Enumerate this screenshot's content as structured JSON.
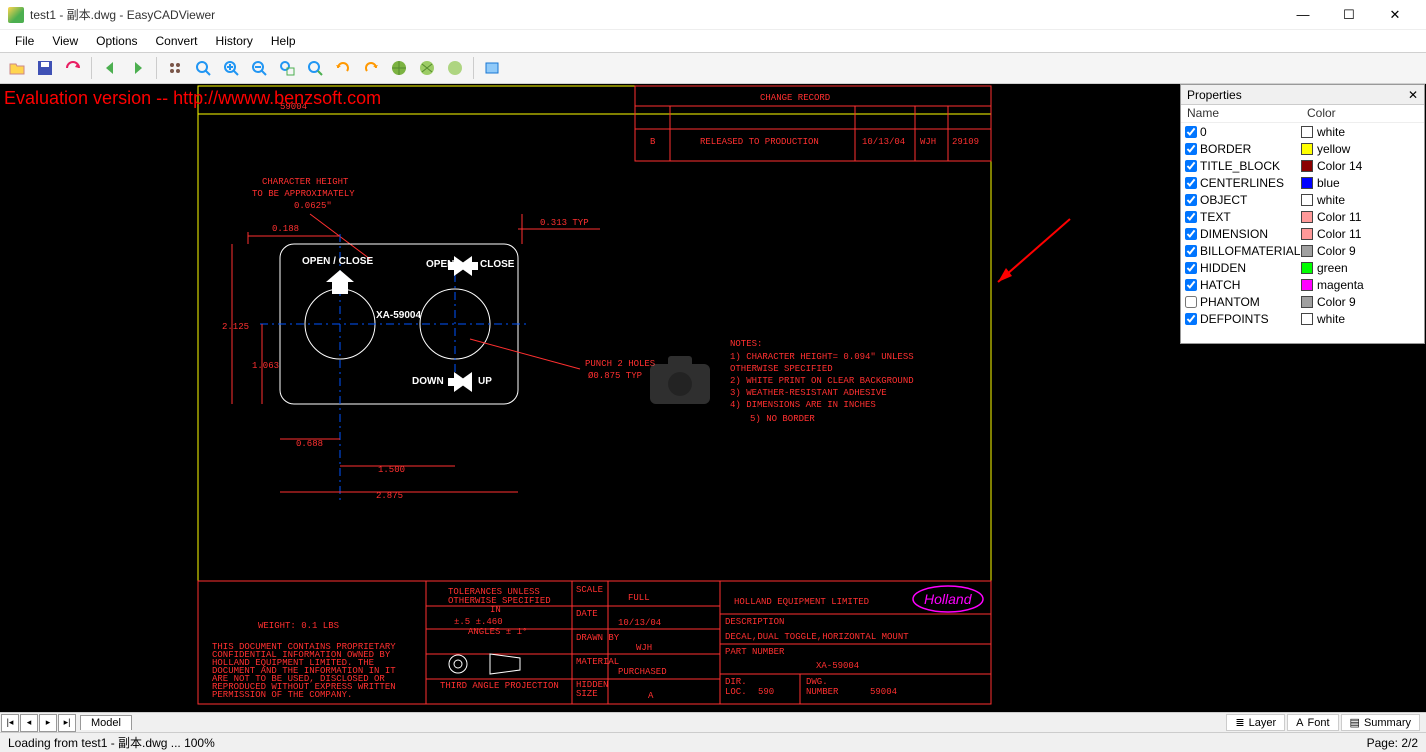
{
  "window": {
    "title": "test1 - 副本.dwg - EasyCADViewer"
  },
  "menu": {
    "file": "File",
    "view": "View",
    "options": "Options",
    "convert": "Convert",
    "history": "History",
    "help": "Help"
  },
  "eval_text": "Evaluation version -- http://wwww.benzsoft.com",
  "drawing": {
    "change_record_title": "CHANGE RECORD",
    "change_row": {
      "rev": "B",
      "desc": "RELEASED TO PRODUCTION",
      "date": "10/13/04",
      "by": "WJH",
      "num": "29109"
    },
    "char_height_note_l1": "CHARACTER HEIGHT",
    "char_height_note_l2": "TO BE APPROXIMATELY",
    "char_height_note_l3": "0.0625\"",
    "dim_313": "0.313 TYP",
    "dim_188": "0.188",
    "dim_2125": "2.125",
    "dim_1063": "1.063",
    "dim_688": "0.688",
    "dim_1500": "1.500",
    "dim_2875": "2.875",
    "open_close": "OPEN / CLOSE",
    "open": "OPEN",
    "close": "CLOSE",
    "down": "DOWN",
    "up": "UP",
    "part_small": "XA-59004",
    "punch_l1": "PUNCH 2 HOLES",
    "punch_l2": "Ø0.875 TYP",
    "notes_title": "NOTES:",
    "notes_1": "1) CHARACTER HEIGHT= 0.094\" UNLESS",
    "notes_1b": "OTHERWISE SPECIFIED",
    "notes_2": "2) WHITE PRINT ON CLEAR BACKGROUND",
    "notes_3": "3) WEATHER-RESISTANT ADHESIVE",
    "notes_4": "4) DIMENSIONS ARE IN INCHES",
    "notes_5": "5) NO BORDER",
    "weight": "WEIGHT: 0.1 LBS",
    "tol_l1": "TOLERANCES UNLESS",
    "tol_l2": "OTHERWISE SPECIFIED",
    "tol_l3": "IN",
    "tol_l4": "±.5    ±.460",
    "tol_l5": "ANGLES ± 1°",
    "proj_note": "THIRD ANGLE PROJECTION",
    "legal_l1": "THIS DOCUMENT CONTAINS PROPRIETARY",
    "legal_l2": "CONFIDENTIAL INFORMATION OWNED BY",
    "legal_l3": "HOLLAND EQUIPMENT LIMITED. THE",
    "legal_l4": "DOCUMENT AND THE INFORMATION IN IT",
    "legal_l5": "ARE NOT TO BE USED, DISCLOSED OR",
    "legal_l6": "REPRODUCED WITHOUT EXPRESS WRITTEN",
    "legal_l7": "PERMISSION OF THE COMPANY.",
    "scale_lbl": "SCALE",
    "scale_val": "FULL",
    "date_lbl": "DATE",
    "date_val": "10/13/04",
    "drawn_lbl": "DRAWN BY",
    "drawn_val": "WJH",
    "material_lbl": "MATERIAL",
    "material_val": "PURCHASED",
    "size_lbl1": "HIDDEN",
    "size_lbl2": "SIZE",
    "size_val": "A",
    "company": "HOLLAND EQUIPMENT LIMITED",
    "logo": "Holland",
    "desc_lbl": "DESCRIPTION",
    "desc_val": "DECAL,DUAL TOGGLE,HORIZONTAL MOUNT",
    "part_lbl": "PART NUMBER",
    "part_val": "XA-59004",
    "dir_lbl": "DIR.",
    "loc_lbl": "LOC.",
    "loc_val": "590",
    "dwg_lbl": "DWG.",
    "num_lbl": "NUMBER",
    "dwg_val": "59004",
    "top_part": "59004"
  },
  "properties": {
    "title": "Properties",
    "col_name": "Name",
    "col_color": "Color",
    "layers": [
      {
        "checked": true,
        "name": "0",
        "color": "#ffffff",
        "label": "white"
      },
      {
        "checked": true,
        "name": "BORDER",
        "color": "#ffff00",
        "label": "yellow"
      },
      {
        "checked": true,
        "name": "TITLE_BLOCK",
        "color": "#8b0000",
        "label": "Color 14"
      },
      {
        "checked": true,
        "name": "CENTERLINES",
        "color": "#0000ff",
        "label": "blue"
      },
      {
        "checked": true,
        "name": "OBJECT",
        "color": "#ffffff",
        "label": "white"
      },
      {
        "checked": true,
        "name": "TEXT",
        "color": "#ff9999",
        "label": "Color 11"
      },
      {
        "checked": true,
        "name": "DIMENSION",
        "color": "#ff9999",
        "label": "Color 11"
      },
      {
        "checked": true,
        "name": "BILLOFMATERIAL",
        "color": "#a0a0a0",
        "label": "Color 9"
      },
      {
        "checked": true,
        "name": "HIDDEN",
        "color": "#00ff00",
        "label": "green"
      },
      {
        "checked": true,
        "name": "HATCH",
        "color": "#ff00ff",
        "label": "magenta"
      },
      {
        "checked": false,
        "name": "PHANTOM",
        "color": "#a0a0a0",
        "label": "Color 9"
      },
      {
        "checked": true,
        "name": "DEFPOINTS",
        "color": "#ffffff",
        "label": "white"
      }
    ]
  },
  "tabs": {
    "model": "Model",
    "layer": "Layer",
    "font": "Font",
    "summary": "Summary"
  },
  "status": {
    "left": "Loading from test1 - 副本.dwg ... 100%",
    "right": "Page: 2/2"
  }
}
